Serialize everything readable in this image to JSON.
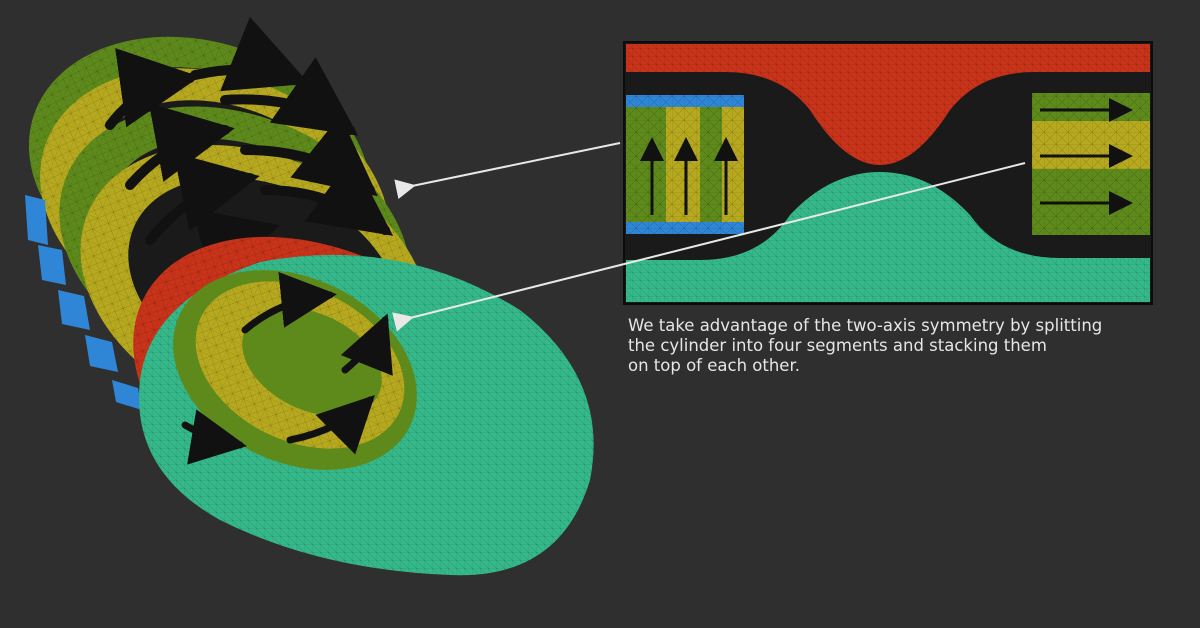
{
  "caption": {
    "lines": [
      "We take advantage of the two-axis symmetry by splitting",
      "the cylinder into four segments and stacking them",
      "on top of each other."
    ]
  },
  "colors": {
    "background": "#2f2f2f",
    "red": "#c8331a",
    "green": "#5e8a1c",
    "yellow": "#b7a91f",
    "blue": "#2f86d6",
    "teal": "#36b98a",
    "inner_dark": "#1a1a1a",
    "arrow": "#111111",
    "pointer": "#e8e8e8"
  }
}
